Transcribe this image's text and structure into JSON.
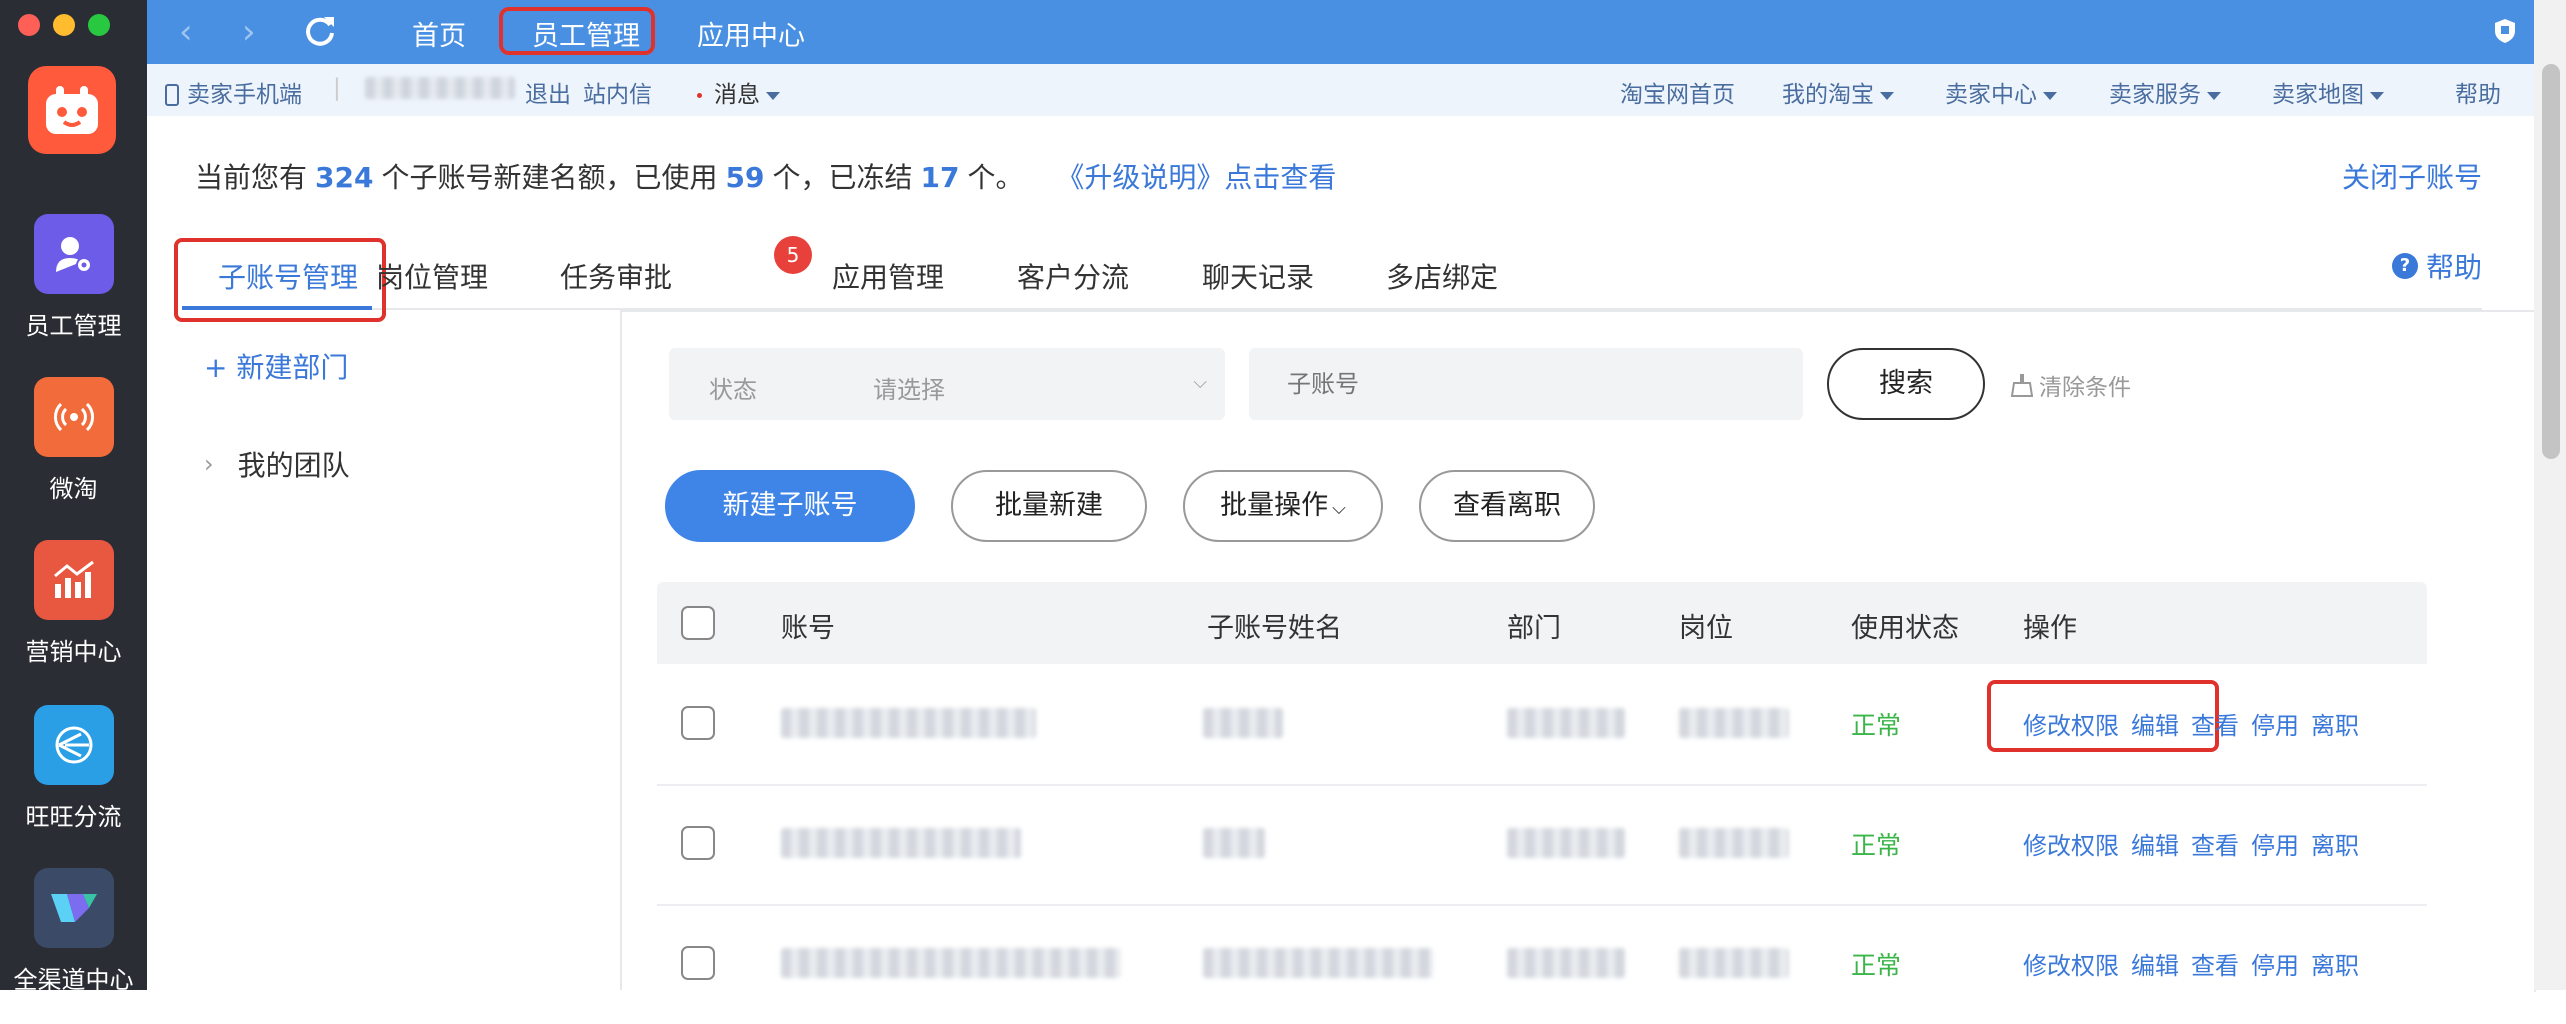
{
  "rail": {
    "items": [
      {
        "label": "员工管理",
        "color": "#6c5ce7"
      },
      {
        "label": "微淘",
        "color": "#f26b3a"
      },
      {
        "label": "营销中心",
        "color": "#e8573f"
      },
      {
        "label": "旺旺分流",
        "color": "#2b9fe6"
      },
      {
        "label": "全渠道中心",
        "color": "#3b4a66"
      }
    ]
  },
  "topbar": {
    "tabs": [
      "首页",
      "员工管理",
      "应用中心"
    ],
    "active_tab": "员工管理"
  },
  "sellerbar": {
    "mobile": "卖家手机端",
    "logout": "退出",
    "inbox": "站内信",
    "messages": "消息",
    "right_links": [
      "淘宝网首页",
      "我的淘宝",
      "卖家中心",
      "卖家服务",
      "卖家地图",
      "帮助"
    ]
  },
  "quota": {
    "prefix": "当前您有",
    "total": "324",
    "mid1": "个子账号新建名额，已使用",
    "used": "59",
    "mid2": "个，已冻结",
    "frozen": "17",
    "suffix": "个。",
    "link": "《升级说明》点击查看",
    "close": "关闭子账号"
  },
  "subtabs": [
    "子账号管理",
    "岗位管理",
    "任务审批",
    "应用管理",
    "客户分流",
    "聊天记录",
    "多店绑定"
  ],
  "task_badge": "5",
  "help": "帮助",
  "left_panel": {
    "new_dept": "+ 新建部门",
    "team": "我的团队"
  },
  "filter": {
    "status_label": "状态",
    "status_placeholder": "请选择",
    "account_placeholder": "子账号",
    "search": "搜索",
    "clear": "清除条件"
  },
  "actions": {
    "new_sub": "新建子账号",
    "batch_new": "批量新建",
    "batch_op": "批量操作",
    "view_resigned": "查看离职"
  },
  "table": {
    "headers": [
      "账号",
      "子账号姓名",
      "部门",
      "岗位",
      "使用状态",
      "操作"
    ],
    "rows": [
      {
        "status": "正常"
      },
      {
        "status": "正常"
      },
      {
        "status": "正常"
      }
    ],
    "ops": [
      "修改权限",
      "编辑",
      "查看",
      "停用",
      "离职"
    ]
  }
}
